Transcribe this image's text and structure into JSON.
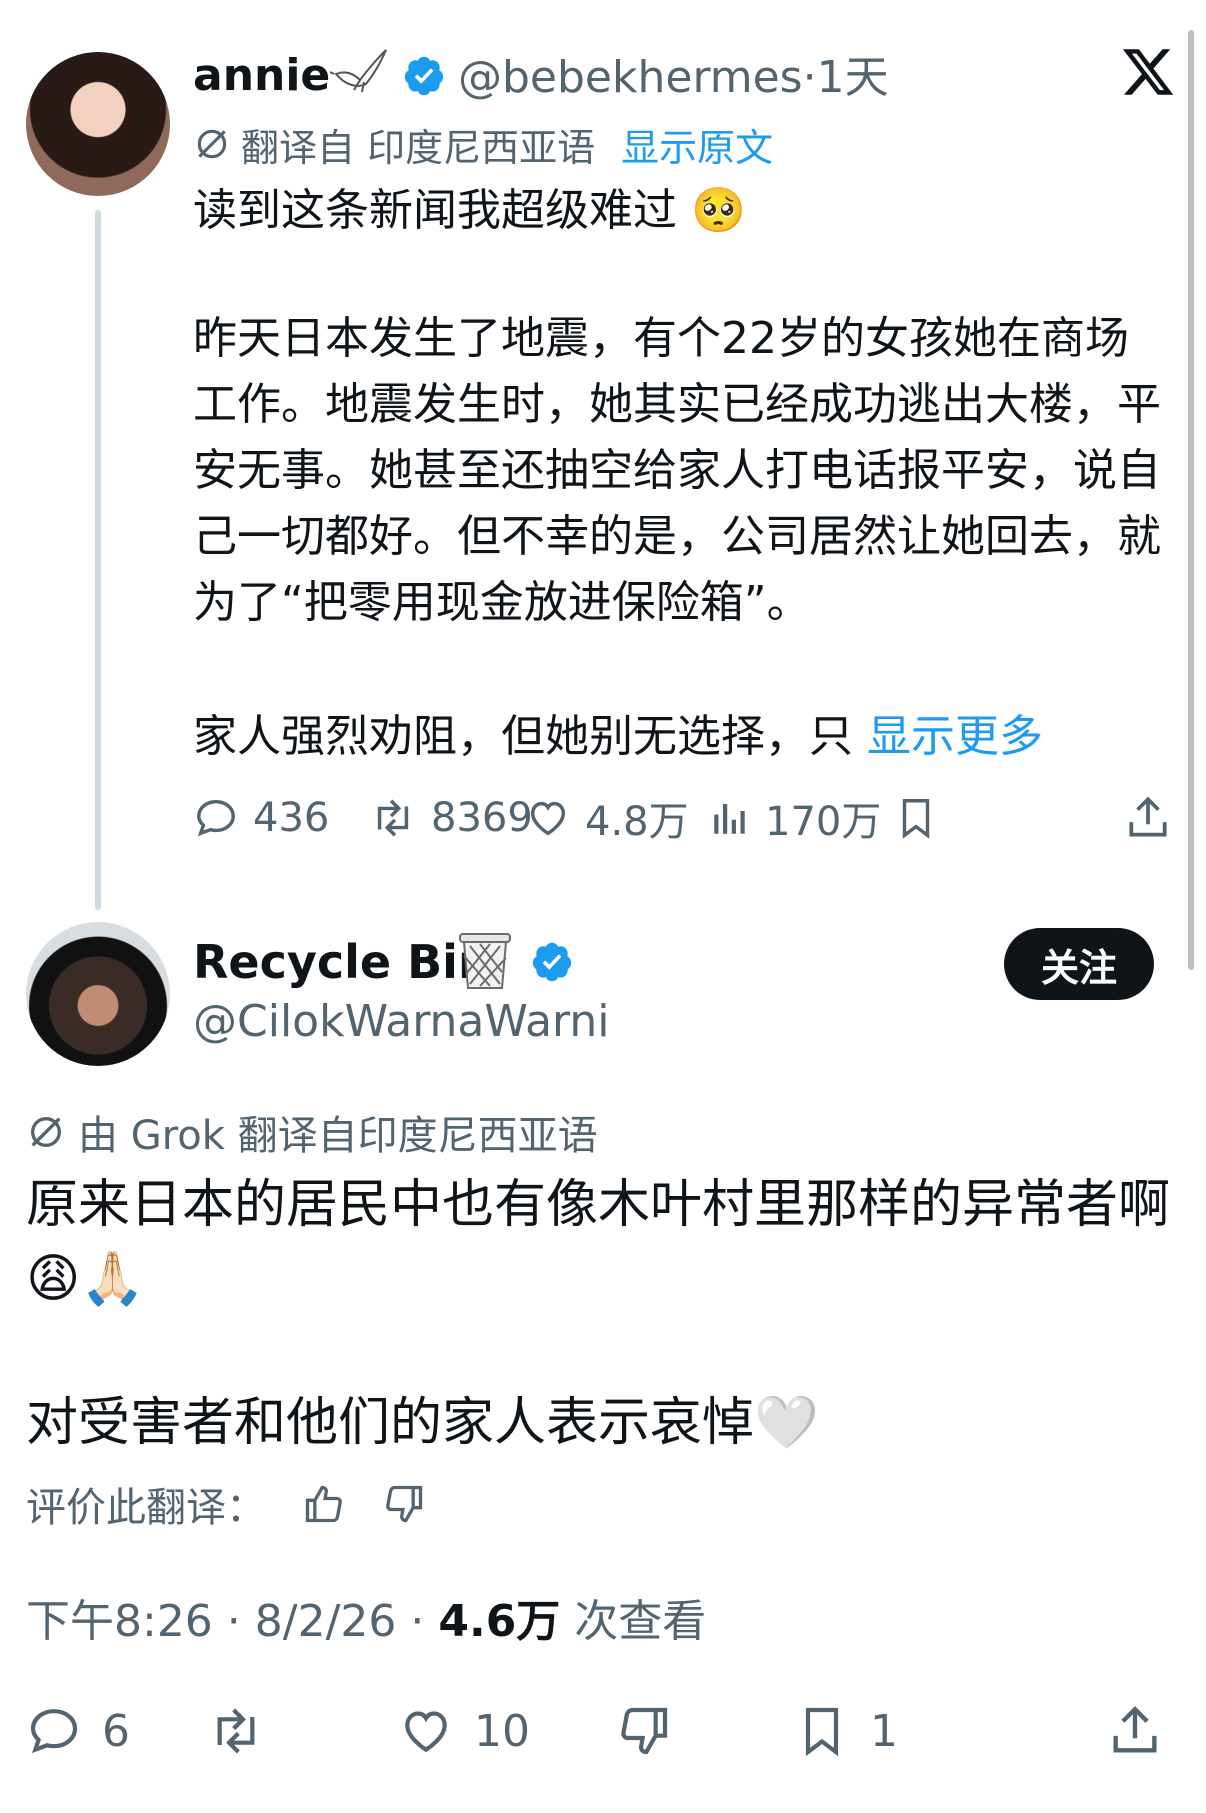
{
  "main_tweet": {
    "name": "annie",
    "handle": "@bebekhermes",
    "time": "·1天",
    "translated_from": "翻译自 印度尼西亚语",
    "show_original": "显示原文",
    "line1": "读到这条新闻我超级难过 🥺",
    "para2": "昨天日本发生了地震，有个22岁的女孩她在商场工作。地震发生时，她其实已经成功逃出大楼，平安无事。她甚至还抽空给家人打电话报平安，说自己一切都好。但不幸的是，公司居然让她回去，就为了“把零用现金放进保险箱”。",
    "para3": "家人强烈劝阻，但她别无选择，只",
    "show_more": "显示更多",
    "replies": "436",
    "reposts": "8369",
    "likes": "4.8万",
    "views": "170万"
  },
  "reply": {
    "name": "Recycle Bin",
    "handle": "@CilokWarnaWarni",
    "follow_label": "关注",
    "translated_by": "由 Grok 翻译自印度尼西亚语",
    "text1": "原来日本的居民中也有像木叶村里那样的异常者啊😩🙏🏻",
    "text2": "对受害者和他们的家人表示哀悼🤍",
    "rate_label": "评价此翻译：",
    "meta_time": "下午8:26 · 8/2/26 · ",
    "meta_views": "4.6万",
    "meta_views_suffix": " 次查看",
    "replies": "6",
    "likes": "10",
    "bookmarks": "1"
  },
  "icons": {
    "verified_color": "#1d9bf0",
    "link_color": "#1d9bf0",
    "text_secondary": "#536471",
    "text_primary": "#0f1419"
  }
}
